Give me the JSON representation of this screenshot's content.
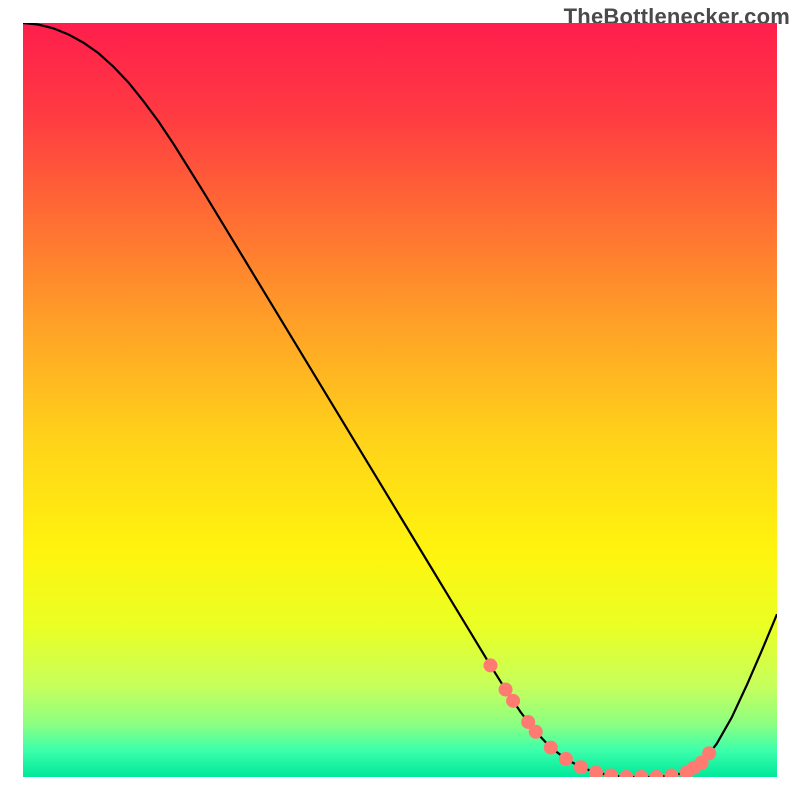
{
  "attribution": "TheBottlenecker.com",
  "chart_data": {
    "type": "line",
    "title": "",
    "xlabel": "",
    "ylabel": "",
    "xlim": [
      0,
      100
    ],
    "ylim": [
      0,
      100
    ],
    "x": [
      0,
      2,
      4,
      6,
      8,
      10,
      12,
      14,
      16,
      18,
      20,
      22,
      24,
      26,
      28,
      30,
      32,
      34,
      36,
      38,
      40,
      42,
      44,
      46,
      48,
      50,
      52,
      54,
      56,
      58,
      60,
      62,
      64,
      66,
      68,
      70,
      72,
      74,
      76,
      78,
      80,
      82,
      84,
      86,
      88,
      90,
      92,
      94,
      96,
      98,
      100
    ],
    "values": [
      100.0,
      99.8,
      99.3,
      98.5,
      97.4,
      96.0,
      94.2,
      92.1,
      89.6,
      86.9,
      83.9,
      80.7,
      77.5,
      74.2,
      70.9,
      67.6,
      64.3,
      61.0,
      57.7,
      54.4,
      51.1,
      47.8,
      44.5,
      41.2,
      37.9,
      34.6,
      31.3,
      28.0,
      24.7,
      21.4,
      18.1,
      14.8,
      11.6,
      8.6,
      6.0,
      3.9,
      2.4,
      1.3,
      0.6,
      0.2,
      0.0,
      0.0,
      0.0,
      0.2,
      0.6,
      1.9,
      4.4,
      7.9,
      12.2,
      16.8,
      21.6
    ],
    "marker_points_x": [
      62,
      64,
      65,
      67,
      68,
      70,
      72,
      74,
      76,
      78,
      80,
      82,
      84,
      86,
      88,
      89,
      90,
      91
    ],
    "gradient_stops": [
      {
        "offset": 0.0,
        "color": "#ff1e4c"
      },
      {
        "offset": 0.12,
        "color": "#ff3a43"
      },
      {
        "offset": 0.25,
        "color": "#ff6a34"
      },
      {
        "offset": 0.4,
        "color": "#ffa127"
      },
      {
        "offset": 0.55,
        "color": "#ffd21a"
      },
      {
        "offset": 0.7,
        "color": "#fff40e"
      },
      {
        "offset": 0.8,
        "color": "#eaff24"
      },
      {
        "offset": 0.88,
        "color": "#c6ff5c"
      },
      {
        "offset": 0.93,
        "color": "#8cff82"
      },
      {
        "offset": 0.965,
        "color": "#3bffab"
      },
      {
        "offset": 1.0,
        "color": "#00e89a"
      }
    ],
    "line_color": "#000000",
    "marker_color": "#ff7b72",
    "background": "#ffffff"
  }
}
